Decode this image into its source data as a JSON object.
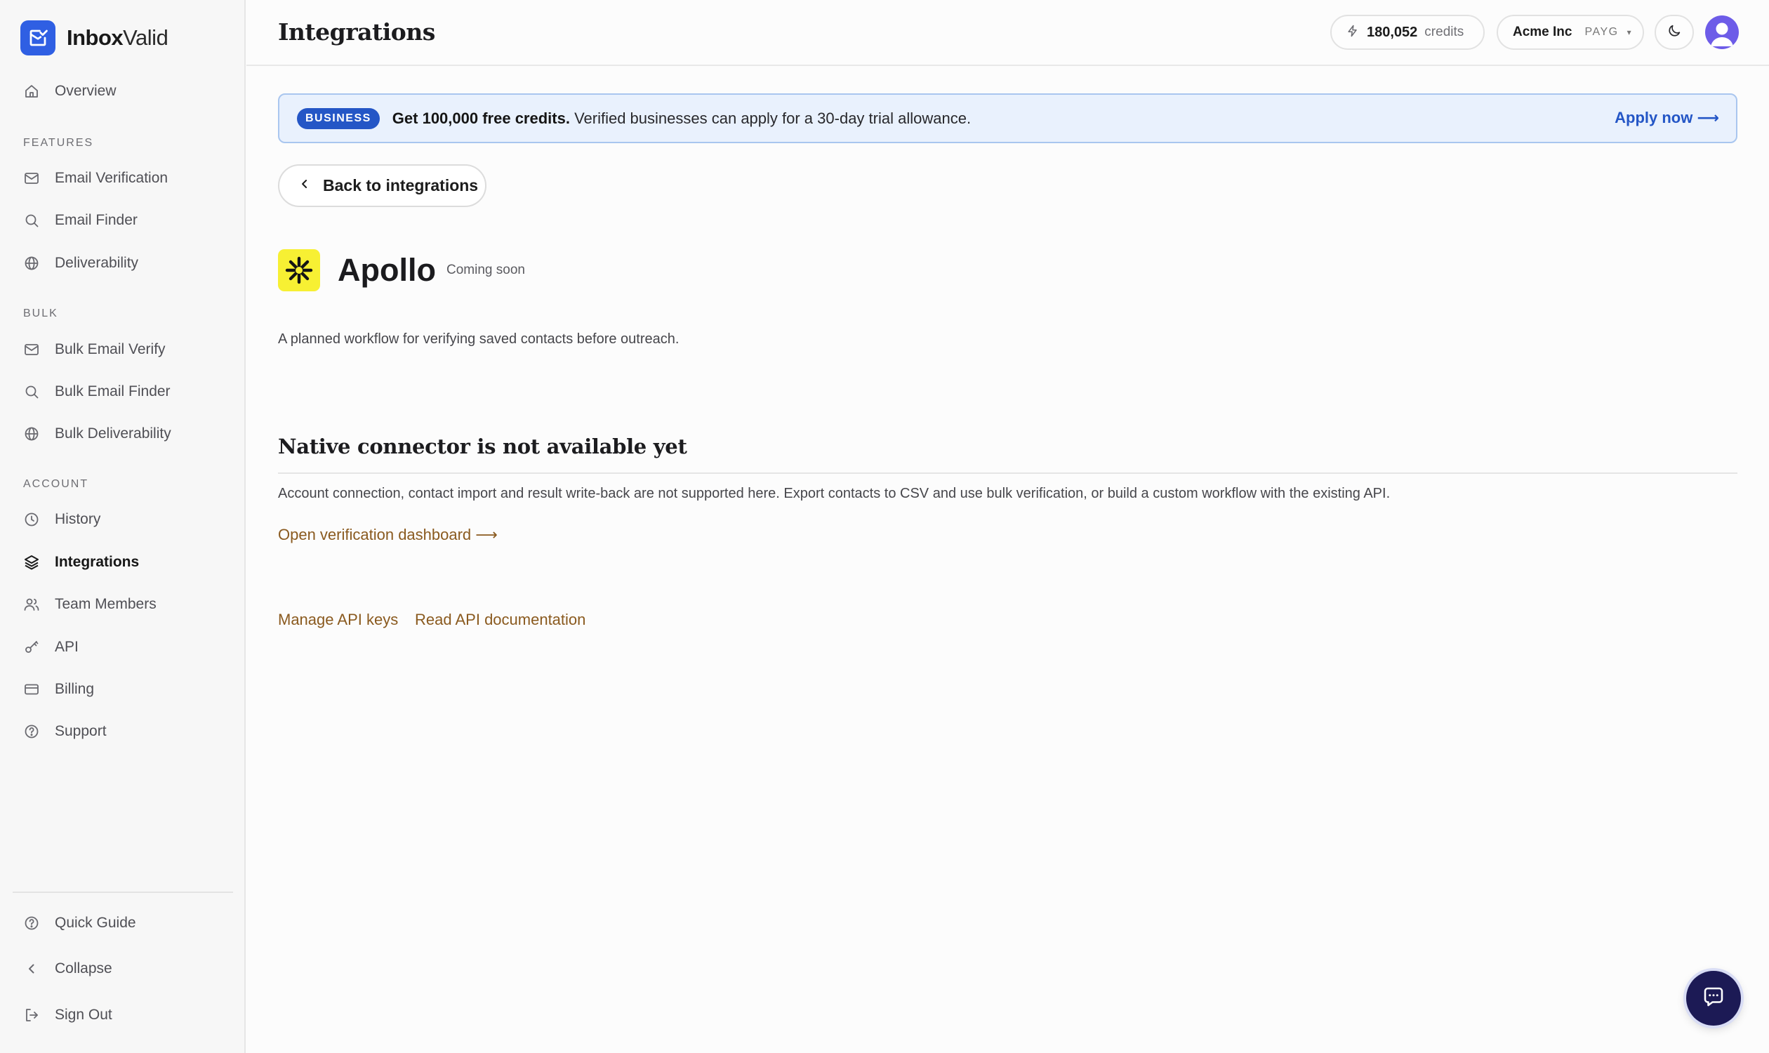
{
  "brand": {
    "name_bold": "Inbox",
    "name_rest": "Valid",
    "accent": "#2f5fe3"
  },
  "sidebar": {
    "overview": "Overview",
    "sections": {
      "features": "FEATURES",
      "bulk": "BULK",
      "account": "ACCOUNT"
    },
    "features": [
      "Email Verification",
      "Email Finder",
      "Deliverability"
    ],
    "bulk": [
      "Bulk Email Verify",
      "Bulk Email Finder",
      "Bulk Deliverability"
    ],
    "account": [
      "History",
      "Integrations",
      "Team Members",
      "API",
      "Billing",
      "Support"
    ],
    "active": "Integrations",
    "footer": [
      "Quick Guide",
      "Collapse",
      "Sign Out"
    ]
  },
  "header": {
    "title": "Integrations",
    "credits_value": "180,052",
    "credits_label": "credits",
    "org_name": "Acme Inc",
    "org_plan": "PAYG",
    "org_caret": "▾"
  },
  "banner": {
    "badge": "BUSINESS",
    "headline": "Get 100,000 free credits.",
    "body": " Verified businesses can apply for a 30-day trial allowance.",
    "cta": "Apply now ⟶"
  },
  "back_button": "Back to integrations",
  "integration": {
    "name": "Apollo",
    "status": "Coming soon",
    "description": "A planned workflow for verifying saved contacts before outreach.",
    "logo_color": "#f7f033"
  },
  "connector": {
    "title": "Native connector is not available yet",
    "body": "Account connection, contact import and result write-back are not supported here. Export contacts to CSV and use bulk verification, or build a custom workflow with the existing API.",
    "dashboard_link": "Open verification dashboard ⟶"
  },
  "footer_links": {
    "api_keys": "Manage API keys",
    "api_docs": "Read API documentation"
  }
}
